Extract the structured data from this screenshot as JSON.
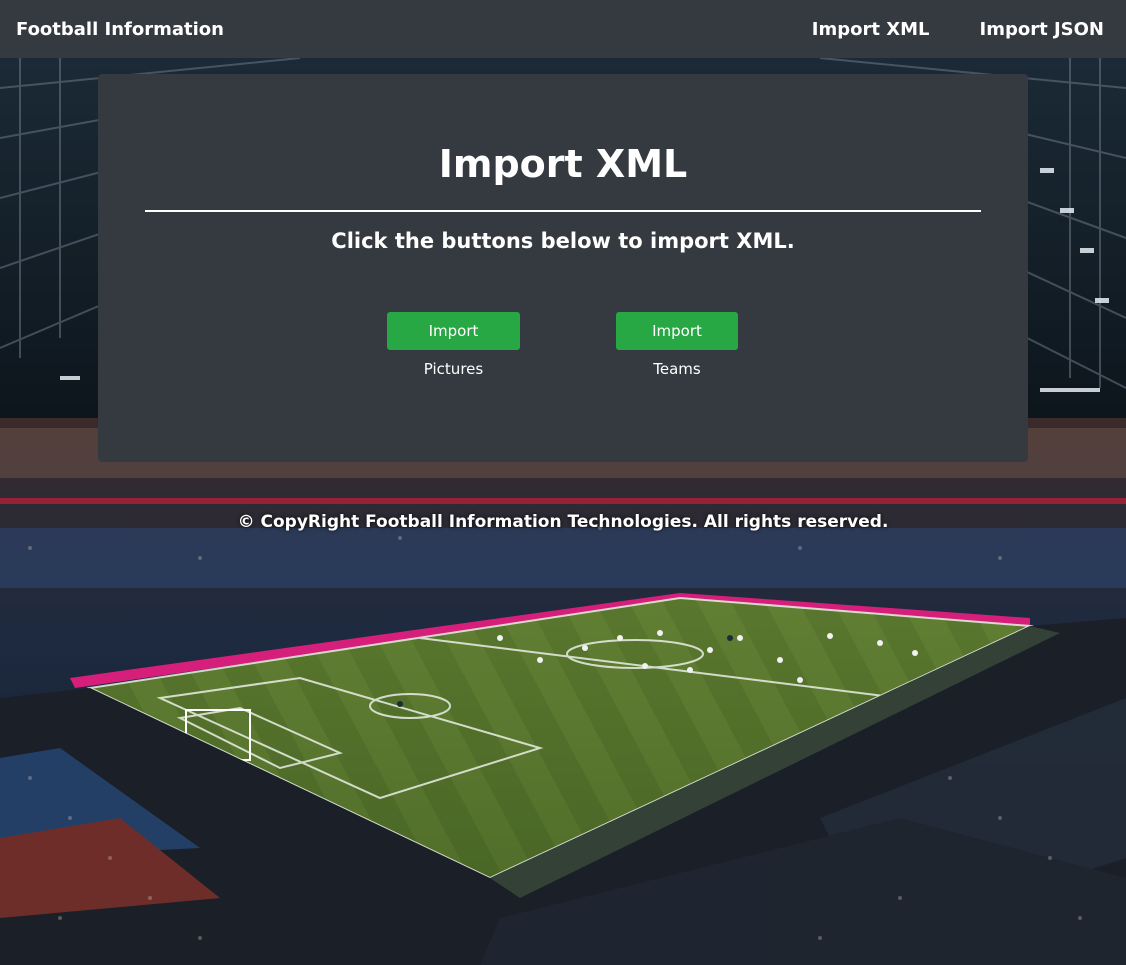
{
  "navbar": {
    "brand": "Football Information",
    "links": [
      "Import XML",
      "Import JSON"
    ]
  },
  "card": {
    "title": "Import XML",
    "subtitle": "Click the buttons below to import XML.",
    "buttons": [
      "Import Pictures",
      "Import Teams"
    ]
  },
  "footer": {
    "text": "© CopyRight Football Information Technologies. All rights reserved."
  },
  "colors": {
    "navbar_bg": "#343a40",
    "card_bg": "#343a40",
    "button_bg": "#28a745",
    "text": "#ffffff"
  }
}
